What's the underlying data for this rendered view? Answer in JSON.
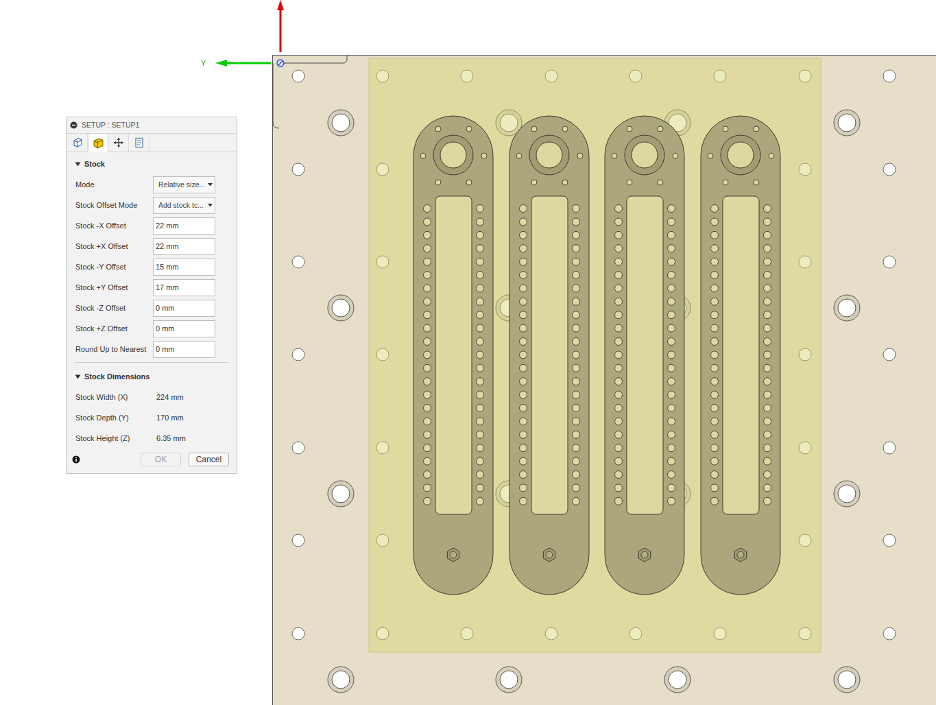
{
  "viewport": {
    "axis_label": "Y"
  },
  "dialog": {
    "title": "SETUP : SETUP1",
    "collapsed": false
  },
  "tabs": [
    {
      "kind": "setup",
      "selected": false
    },
    {
      "kind": "stock",
      "selected": true
    },
    {
      "kind": "origin",
      "selected": false
    },
    {
      "kind": "post",
      "selected": false
    }
  ],
  "sections": [
    {
      "title": "Stock",
      "expanded": true,
      "rows": [
        {
          "label": "Mode",
          "kind": "dropdown",
          "value": "Relative size..."
        },
        {
          "label": "Stock Offset Mode",
          "kind": "dropdown",
          "value": "Add stock tc..."
        },
        {
          "label": "Stock -X Offset",
          "kind": "input",
          "value": "22 mm"
        },
        {
          "label": "Stock +X Offset",
          "kind": "input",
          "value": "22 mm"
        },
        {
          "label": "Stock -Y Offset",
          "kind": "input",
          "value": "15 mm"
        },
        {
          "label": "Stock +Y Offset",
          "kind": "input",
          "value": "17 mm"
        },
        {
          "label": "Stock -Z Offset",
          "kind": "input",
          "value": "0 mm"
        },
        {
          "label": "Stock +Z Offset",
          "kind": "input",
          "value": "0 mm"
        },
        {
          "label": "Round Up to Nearest",
          "kind": "input",
          "value": "0 mm"
        }
      ]
    },
    {
      "title": "Stock Dimensions",
      "expanded": true,
      "rows": [
        {
          "label": "Stock Width (X)",
          "kind": "readout",
          "value": "224 mm"
        },
        {
          "label": "Stock Depth (Y)",
          "kind": "readout",
          "value": "170 mm"
        },
        {
          "label": "Stock Height (Z)",
          "kind": "readout",
          "value": "6.35 mm"
        }
      ]
    }
  ],
  "buttons": [
    {
      "label": "OK",
      "disabled": true
    },
    {
      "label": "Cancel",
      "disabled": false
    }
  ]
}
